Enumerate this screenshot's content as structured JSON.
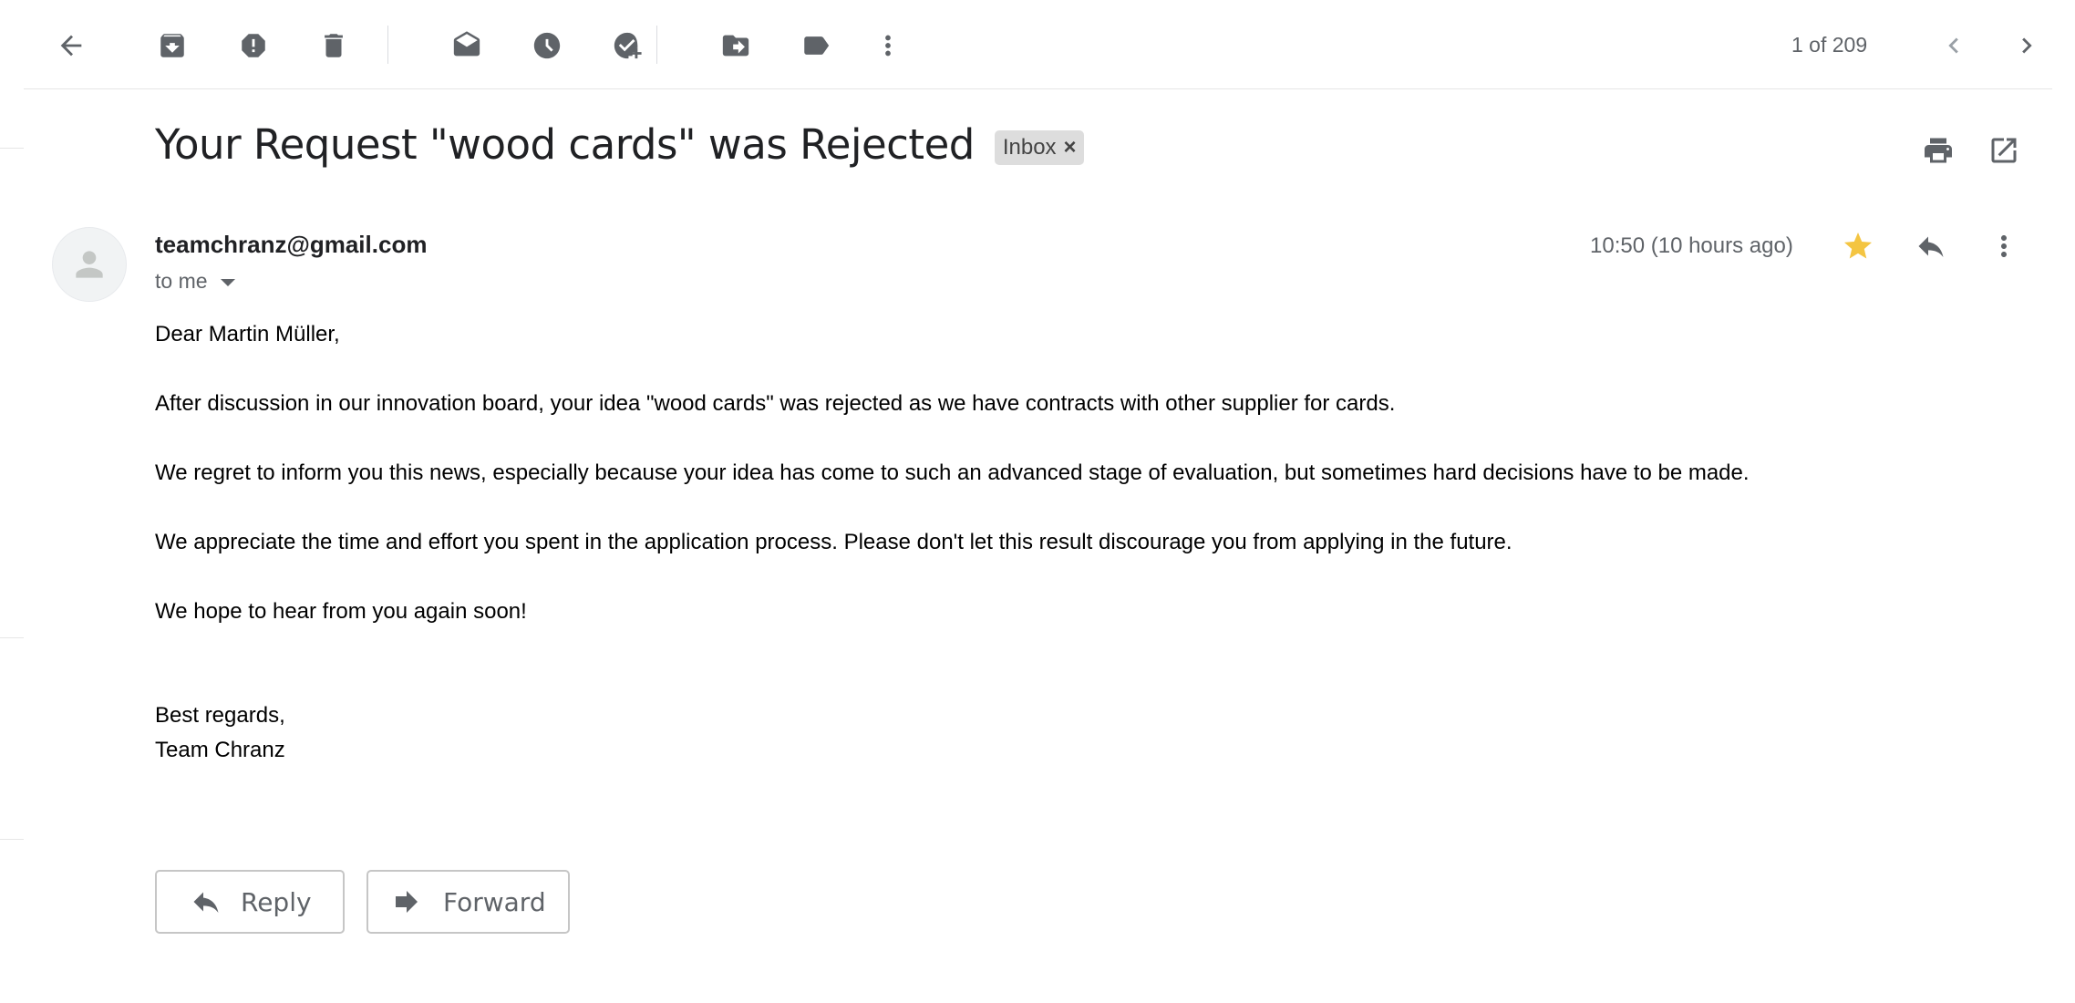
{
  "toolbar": {
    "buttons": [
      {
        "name": "back-button",
        "icon": "arrow-back-icon"
      },
      {
        "name": "archive-button",
        "icon": "archive-icon"
      },
      {
        "name": "report-spam-button",
        "icon": "report-icon"
      },
      {
        "name": "delete-button",
        "icon": "trash-icon"
      },
      {
        "name": "mark-unread-button",
        "icon": "mark-unread-icon"
      },
      {
        "name": "snooze-button",
        "icon": "clock-icon"
      },
      {
        "name": "add-to-tasks-button",
        "icon": "add-task-icon"
      },
      {
        "name": "move-to-button",
        "icon": "move-to-folder-icon"
      },
      {
        "name": "labels-button",
        "icon": "label-icon"
      },
      {
        "name": "more-button",
        "icon": "more-vert-icon"
      }
    ],
    "pager": "1 of 209"
  },
  "message": {
    "subject": "Your Request \"wood cards\" was Rejected",
    "label_chip": "Inbox",
    "sender": "teamchranz@gmail.com",
    "recipient": "to me",
    "timestamp": "10:50 (10 hours ago)",
    "starred": true,
    "star_color": "#f4c542",
    "body": {
      "greeting": "Dear Martin Müller,",
      "p1": "After discussion in our innovation board, your idea \"wood cards\" was rejected as we have contracts with other supplier for cards.",
      "p2": "We regret to inform you this news, especially because your idea has come to such an advanced stage of evaluation, but sometimes hard decisions have to be made.",
      "p3": "We appreciate the time and effort you spent in the application process. Please don't let this result discourage you from applying in the future.",
      "p4": "We hope to hear from you again soon!",
      "closing": "Best regards,",
      "signature": "Team Chranz"
    }
  },
  "actions": {
    "reply": "Reply",
    "forward": "Forward"
  }
}
